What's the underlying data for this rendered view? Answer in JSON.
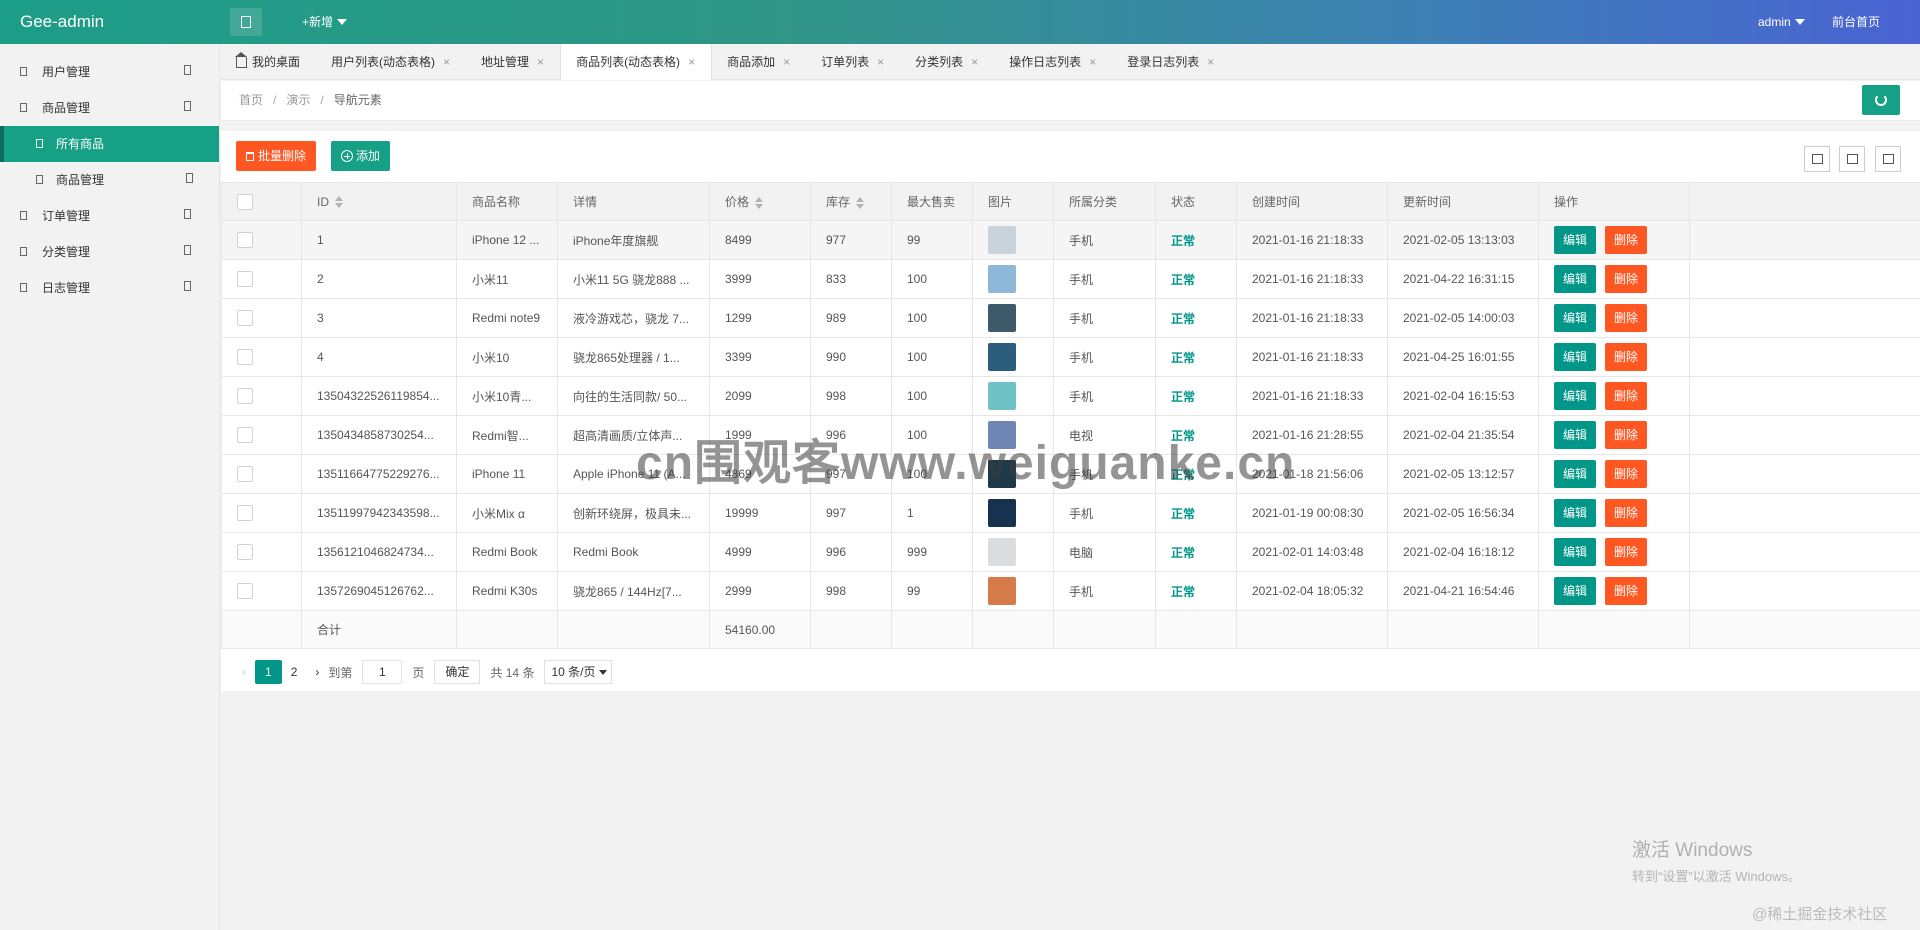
{
  "app": {
    "logo": "Gee-admin",
    "new_label": "+新增",
    "admin_label": "admin",
    "front_label": "前台首页"
  },
  "sidebar": {
    "items": [
      {
        "label": "用户管理"
      },
      {
        "label": "商品管理"
      },
      {
        "label": "所有商品"
      },
      {
        "label": "商品管理"
      },
      {
        "label": "订单管理"
      },
      {
        "label": "分类管理"
      },
      {
        "label": "日志管理"
      }
    ]
  },
  "tabs": [
    {
      "label": "我的桌面"
    },
    {
      "label": "用户列表(动态表格)"
    },
    {
      "label": "地址管理"
    },
    {
      "label": "商品列表(动态表格)"
    },
    {
      "label": "商品添加"
    },
    {
      "label": "订单列表"
    },
    {
      "label": "分类列表"
    },
    {
      "label": "操作日志列表"
    },
    {
      "label": "登录日志列表"
    }
  ],
  "tab_close": "×",
  "breadcrumb": {
    "home": "首页",
    "demo": "演示",
    "current": "导航元素",
    "sep": "/"
  },
  "toolbar": {
    "batch_delete": "批量删除",
    "add": "添加"
  },
  "table": {
    "headers": {
      "id": "ID",
      "name": "商品名称",
      "detail": "详情",
      "price": "价格",
      "stock": "库存",
      "max_sale": "最大售卖",
      "image": "图片",
      "category": "所属分类",
      "status": "状态",
      "created": "创建时间",
      "updated": "更新时间",
      "actions": "操作"
    },
    "edit_label": "编辑",
    "delete_label": "删除",
    "rows": [
      {
        "id": "1",
        "name": "iPhone 12 ...",
        "detail": "iPhone年度旗舰",
        "price": "8499",
        "stock": "977",
        "max": "99",
        "category": "手机",
        "status": "正常",
        "created": "2021-01-16 21:18:33",
        "updated": "2021-02-05 13:13:03",
        "thumb": "#c9d3db"
      },
      {
        "id": "2",
        "name": "小米11",
        "detail": "小米11 5G 骁龙888 ...",
        "price": "3999",
        "stock": "833",
        "max": "100",
        "category": "手机",
        "status": "正常",
        "created": "2021-01-16 21:18:33",
        "updated": "2021-04-22 16:31:15",
        "thumb": "#8fb7d8"
      },
      {
        "id": "3",
        "name": "Redmi note9",
        "detail": "液冷游戏芯，骁龙 7...",
        "price": "1299",
        "stock": "989",
        "max": "100",
        "category": "手机",
        "status": "正常",
        "created": "2021-01-16 21:18:33",
        "updated": "2021-02-05 14:00:03",
        "thumb": "#3c5a6a"
      },
      {
        "id": "4",
        "name": "小米10",
        "detail": "骁龙865处理器 / 1...",
        "price": "3399",
        "stock": "990",
        "max": "100",
        "category": "手机",
        "status": "正常",
        "created": "2021-01-16 21:18:33",
        "updated": "2021-04-25 16:01:55",
        "thumb": "#2d5d7d"
      },
      {
        "id": "13504322526119854...",
        "name": "小米10青...",
        "detail": "向往的生活同款/ 50...",
        "price": "2099",
        "stock": "998",
        "max": "100",
        "category": "手机",
        "status": "正常",
        "created": "2021-01-16 21:18:33",
        "updated": "2021-02-04 16:15:53",
        "thumb": "#6fc3c6"
      },
      {
        "id": "1350434858730254...",
        "name": "Redmi智...",
        "detail": "超高清画质/立体声...",
        "price": "1999",
        "stock": "996",
        "max": "100",
        "category": "电视",
        "status": "正常",
        "created": "2021-01-16 21:28:55",
        "updated": "2021-02-04 21:35:54",
        "thumb": "#6f86b5"
      },
      {
        "id": "13511664775229276...",
        "name": "iPhone 11",
        "detail": "Apple iPhone 11 (A...",
        "price": "4869",
        "stock": "997",
        "max": "100",
        "category": "手机",
        "status": "正常",
        "created": "2021-01-18 21:56:06",
        "updated": "2021-02-05 13:12:57",
        "thumb": "#1e3a4a"
      },
      {
        "id": "13511997942343598...",
        "name": "小米Mix α",
        "detail": "创新环绕屏，极具未...",
        "price": "19999",
        "stock": "997",
        "max": "1",
        "category": "手机",
        "status": "正常",
        "created": "2021-01-19 00:08:30",
        "updated": "2021-02-05 16:56:34",
        "thumb": "#16324f"
      },
      {
        "id": "1356121046824734...",
        "name": "Redmi Book",
        "detail": "Redmi Book",
        "price": "4999",
        "stock": "996",
        "max": "999",
        "category": "电脑",
        "status": "正常",
        "created": "2021-02-01 14:03:48",
        "updated": "2021-02-04 16:18:12",
        "thumb": "#d9dde0"
      },
      {
        "id": "1357269045126762...",
        "name": "Redmi K30s",
        "detail": "骁龙865 / 144Hz[7...",
        "price": "2999",
        "stock": "998",
        "max": "99",
        "category": "手机",
        "status": "正常",
        "created": "2021-02-04 18:05:32",
        "updated": "2021-04-21 16:54:46",
        "thumb": "#d77a4a"
      }
    ],
    "total_label": "合计",
    "total_price": "54160.00"
  },
  "pager": {
    "prev": "‹",
    "page1": "1",
    "page2": "2",
    "next": "›",
    "goto": "到第",
    "input_value": "1",
    "page_unit": "页",
    "confirm": "确定",
    "total": "共 14 条",
    "size": "10 条/页"
  },
  "overlay": {
    "watermark": "cn围观客www.weiguanke.cn",
    "win_title": "激活 Windows",
    "win_sub": "转到“设置”以激活 Windows。",
    "corner": "@稀土掘金技术社区"
  }
}
